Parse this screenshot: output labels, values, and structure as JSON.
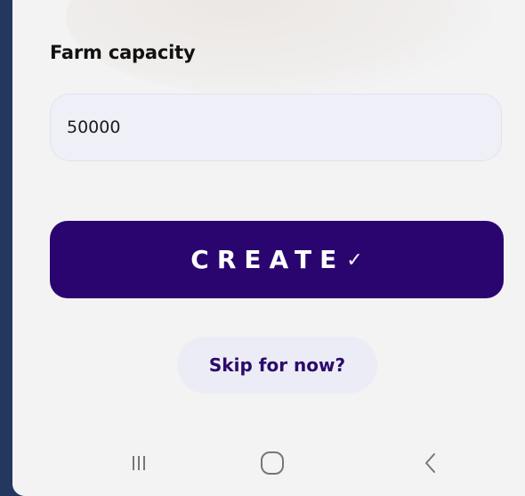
{
  "form": {
    "capacity_label": "Farm capacity",
    "capacity_value": "50000"
  },
  "actions": {
    "create_label": "CREATE",
    "create_icon": "checkmark-icon",
    "skip_label": "Skip for now?"
  },
  "navigation": {
    "buttons": [
      "recent-apps-icon",
      "home-icon",
      "back-icon"
    ]
  },
  "colors": {
    "primary": "#2a0570",
    "skip_text": "#2b0a6b",
    "surface": "#f3f3f4",
    "input_bg": "#efeff8",
    "frame": "#23375f"
  }
}
